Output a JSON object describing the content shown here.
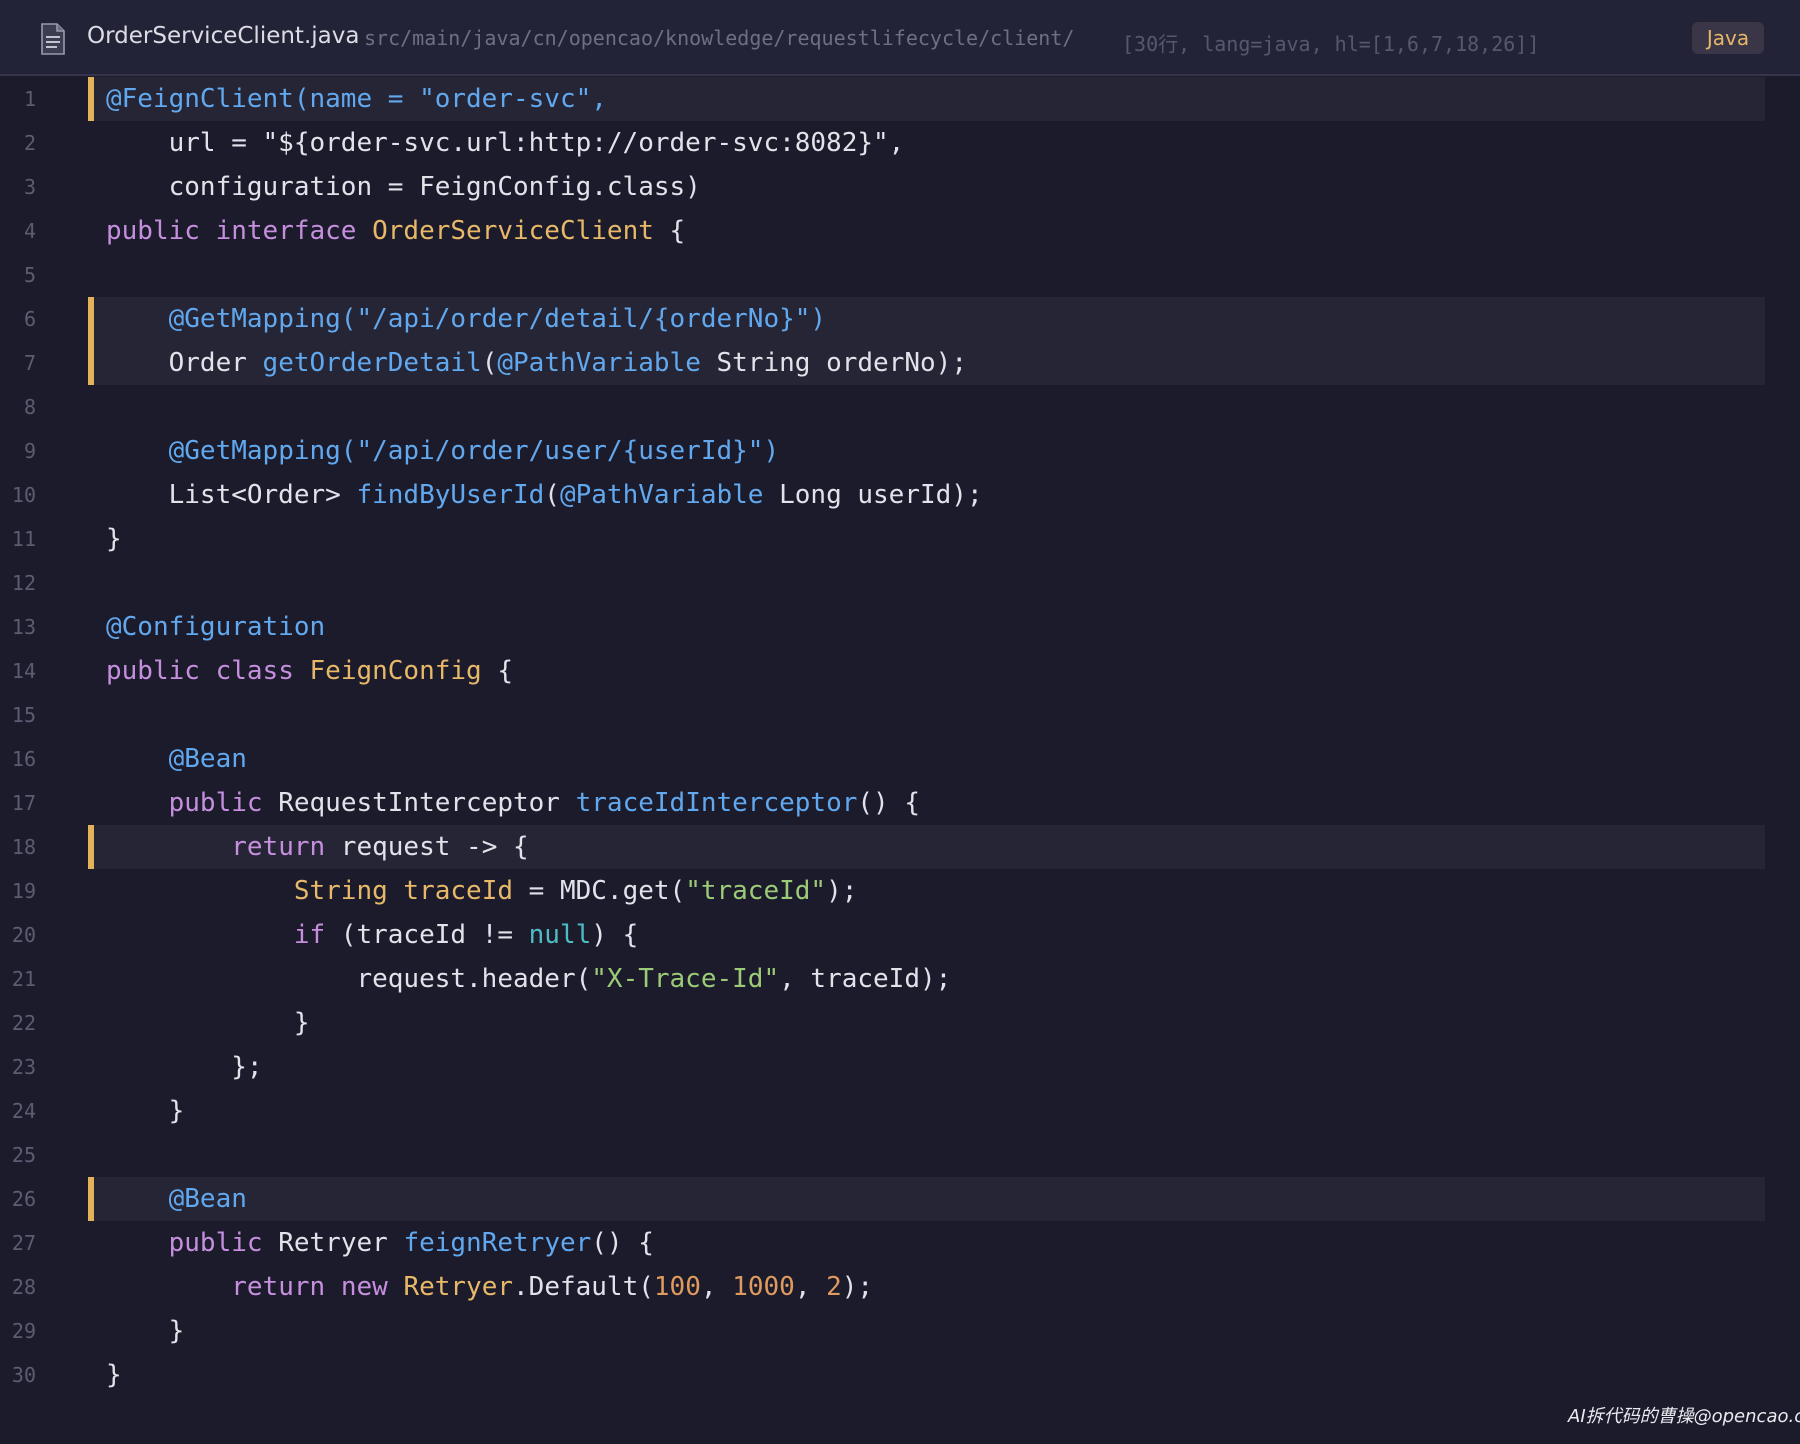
{
  "header": {
    "file_name": "OrderServiceClient.java",
    "file_path": "src/main/java/cn/opencao/knowledge/requestlifecycle/client/",
    "meta": "[30行, lang=java, hl=[1,6,7,18,26]]",
    "language": "Java",
    "icon": "file-icon"
  },
  "code": {
    "highlight_lines": [
      1,
      6,
      7,
      18,
      26
    ],
    "lines": [
      {
        "num": "1",
        "tokens": [
          [
            "ann",
            "@FeignClient(name = \"order-svc\","
          ]
        ]
      },
      {
        "num": "2",
        "tokens": [
          [
            "txt",
            "    url = \"${order-svc.url:http://order-svc:8082}\","
          ]
        ]
      },
      {
        "num": "3",
        "tokens": [
          [
            "txt",
            "    configuration = FeignConfig.class)"
          ]
        ]
      },
      {
        "num": "4",
        "tokens": [
          [
            "kw",
            "public"
          ],
          [
            "txt",
            " "
          ],
          [
            "kw",
            "interface"
          ],
          [
            "txt",
            " "
          ],
          [
            "cls",
            "OrderServiceClient"
          ],
          [
            "txt",
            " {"
          ]
        ]
      },
      {
        "num": "5",
        "tokens": []
      },
      {
        "num": "6",
        "tokens": [
          [
            "txt",
            "    "
          ],
          [
            "ann",
            "@GetMapping(\"/api/order/detail/{orderNo}\")"
          ]
        ]
      },
      {
        "num": "7",
        "tokens": [
          [
            "txt",
            "    Order "
          ],
          [
            "fn",
            "getOrderDetail"
          ],
          [
            "txt",
            "("
          ],
          [
            "ann",
            "@PathVariable"
          ],
          [
            "txt",
            " String orderNo);"
          ]
        ]
      },
      {
        "num": "8",
        "tokens": []
      },
      {
        "num": "9",
        "tokens": [
          [
            "txt",
            "    "
          ],
          [
            "ann",
            "@GetMapping(\"/api/order/user/{userId}\")"
          ]
        ]
      },
      {
        "num": "10",
        "tokens": [
          [
            "txt",
            "    List<Order> "
          ],
          [
            "fn",
            "findByUserId"
          ],
          [
            "txt",
            "("
          ],
          [
            "ann",
            "@PathVariable"
          ],
          [
            "txt",
            " Long userId);"
          ]
        ]
      },
      {
        "num": "11",
        "tokens": [
          [
            "txt",
            "}"
          ]
        ]
      },
      {
        "num": "12",
        "tokens": []
      },
      {
        "num": "13",
        "tokens": [
          [
            "ann",
            "@Configuration"
          ]
        ]
      },
      {
        "num": "14",
        "tokens": [
          [
            "kw",
            "public"
          ],
          [
            "txt",
            " "
          ],
          [
            "kw",
            "class"
          ],
          [
            "txt",
            " "
          ],
          [
            "cls",
            "FeignConfig"
          ],
          [
            "txt",
            " {"
          ]
        ]
      },
      {
        "num": "15",
        "tokens": []
      },
      {
        "num": "16",
        "tokens": [
          [
            "txt",
            "    "
          ],
          [
            "ann",
            "@Bean"
          ]
        ]
      },
      {
        "num": "17",
        "tokens": [
          [
            "txt",
            "    "
          ],
          [
            "kw",
            "public"
          ],
          [
            "txt",
            " RequestInterceptor "
          ],
          [
            "fn",
            "traceIdInterceptor"
          ],
          [
            "txt",
            "() {"
          ]
        ]
      },
      {
        "num": "18",
        "tokens": [
          [
            "txt",
            "        "
          ],
          [
            "kw",
            "return"
          ],
          [
            "txt",
            " request -> {"
          ]
        ]
      },
      {
        "num": "19",
        "tokens": [
          [
            "txt",
            "            "
          ],
          [
            "cls",
            "String"
          ],
          [
            "txt",
            " "
          ],
          [
            "cls",
            "traceId"
          ],
          [
            "txt",
            " = MDC.get("
          ],
          [
            "str",
            "\"traceId\""
          ],
          [
            "txt",
            ");"
          ]
        ]
      },
      {
        "num": "20",
        "tokens": [
          [
            "txt",
            "            "
          ],
          [
            "kw",
            "if"
          ],
          [
            "txt",
            " (traceId != "
          ],
          [
            "lit",
            "null"
          ],
          [
            "txt",
            ") {"
          ]
        ]
      },
      {
        "num": "21",
        "tokens": [
          [
            "txt",
            "                request.header("
          ],
          [
            "str",
            "\"X-Trace-Id\""
          ],
          [
            "txt",
            ", traceId);"
          ]
        ]
      },
      {
        "num": "22",
        "tokens": [
          [
            "txt",
            "            }"
          ]
        ]
      },
      {
        "num": "23",
        "tokens": [
          [
            "txt",
            "        };"
          ]
        ]
      },
      {
        "num": "24",
        "tokens": [
          [
            "txt",
            "    }"
          ]
        ]
      },
      {
        "num": "25",
        "tokens": []
      },
      {
        "num": "26",
        "tokens": [
          [
            "txt",
            "    "
          ],
          [
            "ann",
            "@Bean"
          ]
        ]
      },
      {
        "num": "27",
        "tokens": [
          [
            "txt",
            "    "
          ],
          [
            "kw",
            "public"
          ],
          [
            "txt",
            " Retryer "
          ],
          [
            "fn",
            "feignRetryer"
          ],
          [
            "txt",
            "() {"
          ]
        ]
      },
      {
        "num": "28",
        "tokens": [
          [
            "txt",
            "        "
          ],
          [
            "kw",
            "return"
          ],
          [
            "txt",
            " "
          ],
          [
            "kw",
            "new"
          ],
          [
            "txt",
            " "
          ],
          [
            "cls",
            "Retryer"
          ],
          [
            "txt",
            ".Default("
          ],
          [
            "num",
            "100"
          ],
          [
            "txt",
            ", "
          ],
          [
            "num",
            "1000"
          ],
          [
            "txt",
            ", "
          ],
          [
            "num",
            "2"
          ],
          [
            "txt",
            ");"
          ]
        ]
      },
      {
        "num": "29",
        "tokens": [
          [
            "txt",
            "    }"
          ]
        ]
      },
      {
        "num": "30",
        "tokens": [
          [
            "txt",
            "}"
          ]
        ]
      }
    ]
  },
  "watermark": "AI拆代码的曹操@opencao.cn",
  "colors": {
    "background": "#1b1b2c",
    "highlight_bar": "#e5b25a",
    "annotation": "#61a8ee",
    "keyword": "#c68fde",
    "class": "#e8b869",
    "string": "#9ccb77",
    "number": "#df9a5d"
  }
}
